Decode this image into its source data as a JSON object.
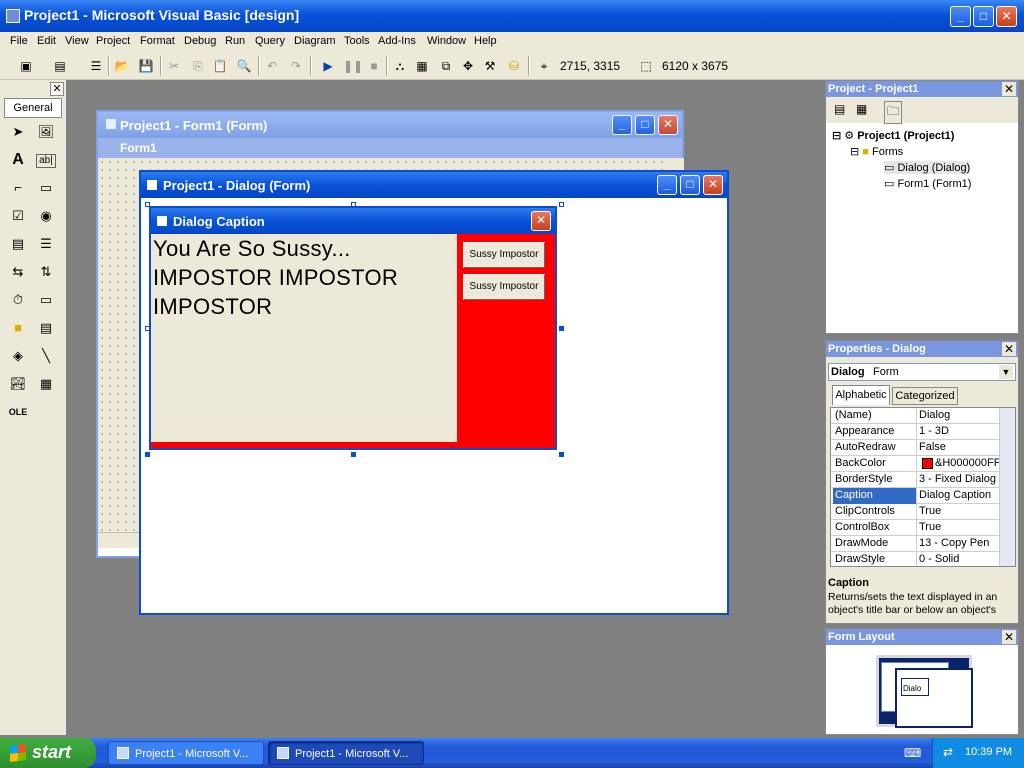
{
  "app": {
    "title": "Project1 - Microsoft Visual Basic [design]"
  },
  "menu": [
    "File",
    "Edit",
    "View",
    "Project",
    "Format",
    "Debug",
    "Run",
    "Query",
    "Diagram",
    "Tools",
    "Add-Ins",
    "Window",
    "Help"
  ],
  "toolbar": {
    "position": "2715, 3315",
    "size": "6120 x 3675"
  },
  "toolbox": {
    "tab": "General"
  },
  "form1": {
    "title": "Project1 - Form1 (Form)",
    "inner_title": "Form1"
  },
  "dialog_form": {
    "title": "Project1 - Dialog (Form)"
  },
  "dialog": {
    "caption": "Dialog Caption",
    "text": "You Are So Sussy... IMPOSTOR IMPOSTOR IMPOSTOR",
    "button1": "Sussy Impostor",
    "button2": "Sussy Impostor",
    "backcolor": "#ff0000"
  },
  "project": {
    "title": "Project - Project1",
    "root": "Project1 (Project1)",
    "folder": "Forms",
    "items": [
      "Dialog (Dialog)",
      "Form1 (Form1)"
    ]
  },
  "properties": {
    "title": "Properties - Dialog",
    "object": "Dialog",
    "object_type": "Form",
    "tabs": [
      "Alphabetic",
      "Categorized"
    ],
    "rows": [
      {
        "name": "(Name)",
        "value": "Dialog"
      },
      {
        "name": "Appearance",
        "value": "1 - 3D"
      },
      {
        "name": "AutoRedraw",
        "value": "False"
      },
      {
        "name": "BackColor",
        "value": "&H000000FF"
      },
      {
        "name": "BorderStyle",
        "value": "3 - Fixed Dialog"
      },
      {
        "name": "Caption",
        "value": "Dialog Caption"
      },
      {
        "name": "ClipControls",
        "value": "True"
      },
      {
        "name": "ControlBox",
        "value": "True"
      },
      {
        "name": "DrawMode",
        "value": "13 - Copy Pen"
      },
      {
        "name": "DrawStyle",
        "value": "0 - Solid"
      }
    ],
    "desc_title": "Caption",
    "desc_text": "Returns/sets the text displayed in an object's title bar or below an object's"
  },
  "form_layout": {
    "title": "Form Layout",
    "mini_label": "Dialo"
  },
  "taskbar": {
    "start": "start",
    "tasks": [
      "Project1 - Microsoft V...",
      "Project1 - Microsoft V..."
    ],
    "clock": "10:39 PM"
  }
}
